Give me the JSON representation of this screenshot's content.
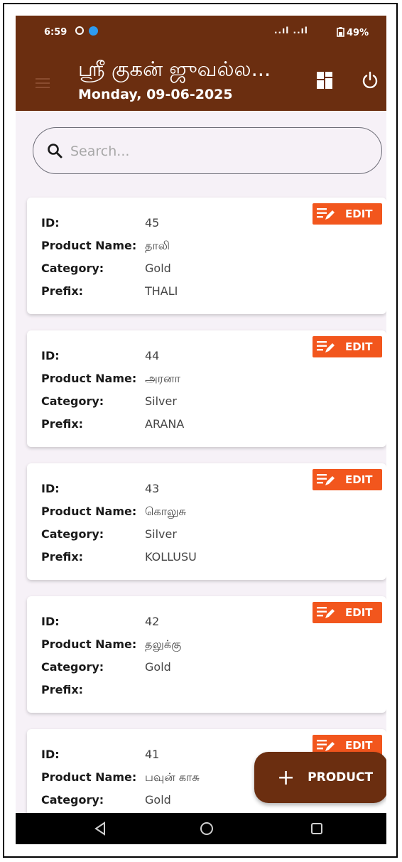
{
  "status_bar": {
    "time": "6:59",
    "signal": "..ıl ..ıl",
    "battery": "49%"
  },
  "header": {
    "title": "ஸ்ரீ குகன் ஜுவல்ல...",
    "date": "Monday, 09-06-2025"
  },
  "search": {
    "placeholder": "Search..."
  },
  "labels": {
    "id": "ID:",
    "product_name": "Product Name:",
    "category": "Category:",
    "prefix": "Prefix:",
    "edit": "EDIT"
  },
  "products": [
    {
      "id": "45",
      "name": "தாலி",
      "category": "Gold",
      "prefix": "THALI"
    },
    {
      "id": "44",
      "name": "அரனா",
      "category": "Silver",
      "prefix": "ARANA"
    },
    {
      "id": "43",
      "name": "கொலுசு",
      "category": "Silver",
      "prefix": "KOLLUSU"
    },
    {
      "id": "42",
      "name": "தலுக்கு",
      "category": "Gold",
      "prefix": ""
    },
    {
      "id": "41",
      "name": "பவுன் காசு",
      "category": "Gold",
      "prefix": ""
    }
  ],
  "fab": {
    "plus": "+",
    "label": "PRODUCT"
  },
  "colors": {
    "primary": "#6b2e10",
    "accent": "#f2561d",
    "background": "#f6f1f7"
  },
  "icons": [
    "menu-icon",
    "dashboard-icon",
    "power-icon",
    "search-icon",
    "edit-icon",
    "back-icon",
    "home-icon",
    "recents-icon"
  ]
}
